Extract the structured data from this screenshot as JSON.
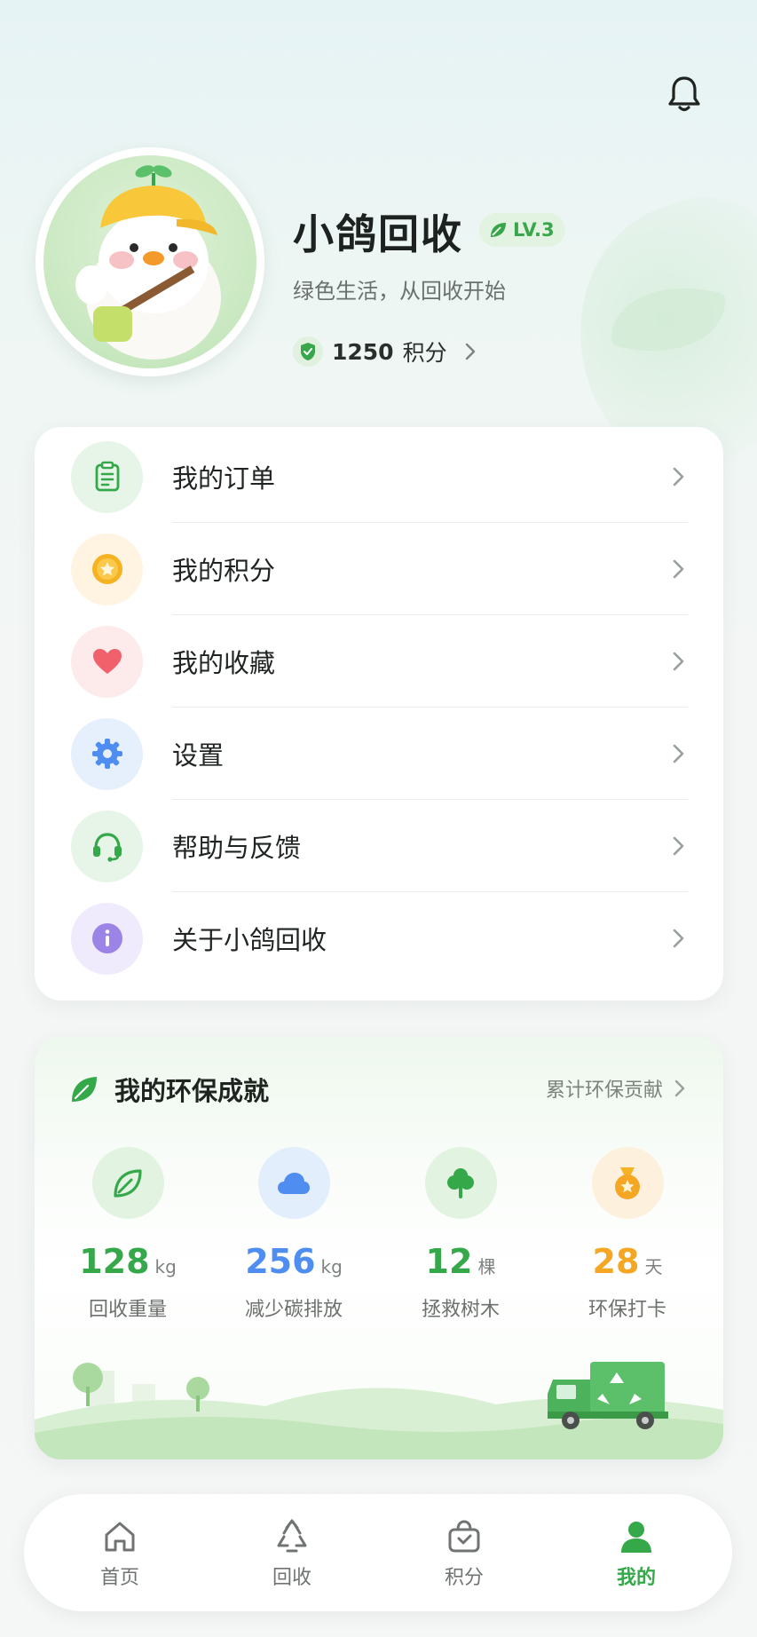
{
  "profile": {
    "name": "小鸽回收",
    "level": "LV.3",
    "motto": "绿色生活，从回收开始",
    "points_value": "1250",
    "points_unit": "积分"
  },
  "menu": [
    {
      "label": "我的订单",
      "icon": "clipboard-icon",
      "color": "#35a84a"
    },
    {
      "label": "我的积分",
      "icon": "coin-star-icon",
      "color": "#f5b324"
    },
    {
      "label": "我的收藏",
      "icon": "heart-icon",
      "color": "#f0616c"
    },
    {
      "label": "设置",
      "icon": "gear-icon",
      "color": "#4f8ef0"
    },
    {
      "label": "帮助与反馈",
      "icon": "headset-icon",
      "color": "#35a84a"
    },
    {
      "label": "关于小鸽回收",
      "icon": "info-icon",
      "color": "#9b84e6"
    }
  ],
  "achievements": {
    "title": "我的环保成就",
    "link": "累计环保贡献",
    "stats": [
      {
        "value": "128",
        "unit": "kg",
        "label": "回收重量",
        "icon": "leaf-icon",
        "color": "#35a84a"
      },
      {
        "value": "256",
        "unit": "kg",
        "label": "减少碳排放",
        "icon": "cloud-icon",
        "color": "#4f8ef0"
      },
      {
        "value": "12",
        "unit": "棵",
        "label": "拯救树木",
        "icon": "tree-icon",
        "color": "#35a84a"
      },
      {
        "value": "28",
        "unit": "天",
        "label": "环保打卡",
        "icon": "medal-icon",
        "color": "#f5a623"
      }
    ]
  },
  "nav": {
    "items": [
      {
        "label": "首页",
        "icon": "home-icon"
      },
      {
        "label": "回收",
        "icon": "recycle-icon"
      },
      {
        "label": "积分",
        "icon": "shopping-bag-icon"
      },
      {
        "label": "我的",
        "icon": "user-icon",
        "active": true
      }
    ],
    "active_color": "#35a84a"
  }
}
